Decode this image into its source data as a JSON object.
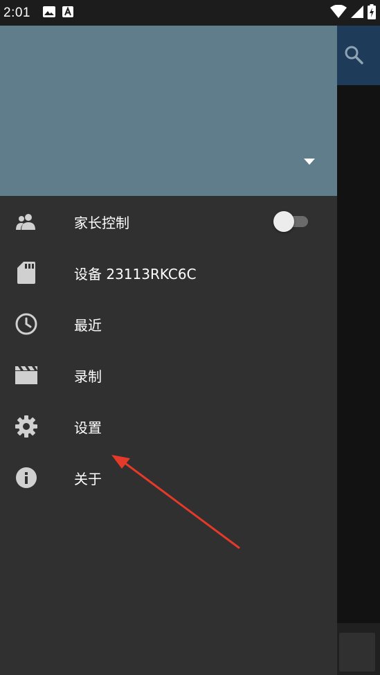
{
  "status_bar": {
    "time": "2:01",
    "icons": [
      "image-icon",
      "a-badge-icon",
      "wifi-icon",
      "signal-icon",
      "battery-charging-icon"
    ]
  },
  "drawer": {
    "header_color": "#607d8b",
    "background": "#303030",
    "items": [
      {
        "icon": "people-icon",
        "label": "家长控制",
        "toggle": true,
        "toggle_on": false
      },
      {
        "icon": "sd-card-icon",
        "label": "设备 23113RKC6C"
      },
      {
        "icon": "clock-icon",
        "label": "最近"
      },
      {
        "icon": "film-icon",
        "label": "录制"
      },
      {
        "icon": "gear-icon",
        "label": "设置"
      },
      {
        "icon": "info-icon",
        "label": "关于"
      }
    ]
  },
  "background_app": {
    "app_bar_color": "#1e3b5a",
    "icons": [
      "search-icon"
    ]
  },
  "annotation": {
    "color": "#e53a2a",
    "points_to": "设置"
  }
}
